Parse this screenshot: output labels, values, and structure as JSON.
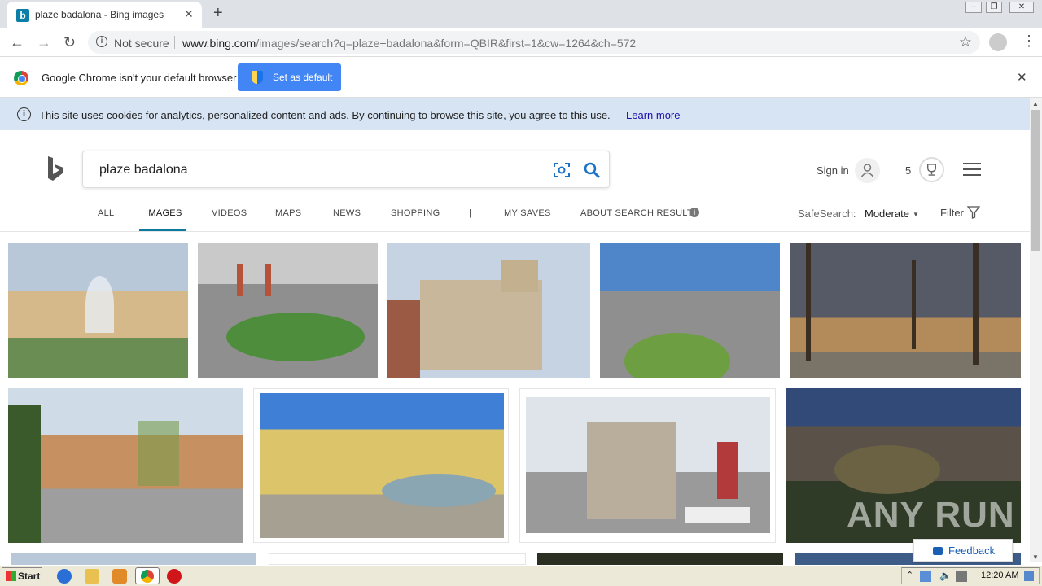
{
  "browser": {
    "tab_title": "plaze badalona - Bing images",
    "favicon_letter": "b",
    "new_tab_label": "+",
    "security_label": "Not secure",
    "url_host": "www.bing.com",
    "url_rest": "/images/search?q=plaze+badalona&form=QBIR&first=1&cw=1264&ch=572"
  },
  "infobar": {
    "message": "Google Chrome isn't your default browser",
    "button": "Set as default"
  },
  "cookie_bar": {
    "text": "This site uses cookies for analytics, personalized content and ads. By continuing to browse this site, you agree to this use.",
    "link": "Learn more"
  },
  "bing": {
    "query": "plaze badalona",
    "sign_in": "Sign in",
    "rewards_points": "5",
    "scopes": [
      "ALL",
      "IMAGES",
      "VIDEOS",
      "MAPS",
      "NEWS",
      "SHOPPING",
      "|",
      "MY SAVES",
      "ABOUT SEARCH RESULTS"
    ],
    "safesearch_label": "SafeSearch:",
    "safesearch_value": "Moderate",
    "filter_label": "Filter"
  },
  "watermark": "ANY RUN",
  "feedback": "Feedback",
  "taskbar": {
    "start": "Start",
    "clock": "12:20 AM"
  },
  "colors": {
    "accent": "#0c7a9e",
    "chrome_button": "#4285f4",
    "cookie_bg": "#d7e4f3"
  }
}
